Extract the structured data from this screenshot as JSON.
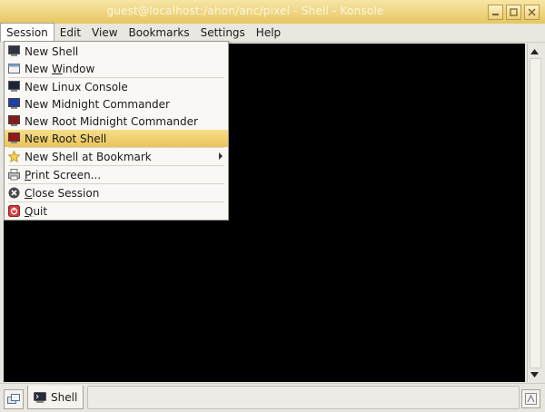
{
  "window": {
    "title": "guest@localhost:/ahon/anc/pixel - Shell - Konsole"
  },
  "menubar": [
    "Session",
    "Edit",
    "View",
    "Bookmarks",
    "Settings",
    "Help"
  ],
  "session_menu": {
    "items": [
      {
        "label": "New Shell",
        "icon": "terminal-icon"
      },
      {
        "label": "New Window",
        "icon": "window-icon"
      },
      {
        "label": "New Linux Console",
        "icon": "linux-console-icon"
      },
      {
        "label": "New Midnight Commander",
        "icon": "midnight-commander-icon"
      },
      {
        "label": "New Root Midnight Commander",
        "icon": "root-midnight-commander-icon"
      },
      {
        "label": "New Root Shell",
        "icon": "root-shell-icon",
        "highlighted": true
      },
      {
        "label": "New Shell at Bookmark",
        "icon": "star-icon",
        "submenu": true
      },
      {
        "label": "Print Screen...",
        "icon": "printer-icon"
      },
      {
        "label": "Close Session",
        "icon": "close-session-icon"
      },
      {
        "label": "Quit",
        "icon": "quit-icon"
      }
    ]
  },
  "tabs": [
    {
      "label": "Shell",
      "icon": "terminal-icon"
    }
  ],
  "colors": {
    "title_gradient_top": "#f7e6a6",
    "title_gradient_bottom": "#e7c662",
    "highlight": "#eac45a",
    "terminal_bg": "#000000"
  }
}
